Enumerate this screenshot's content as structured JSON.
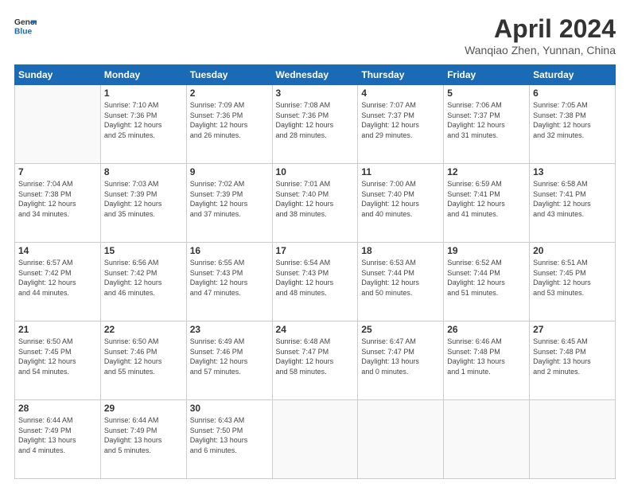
{
  "logo": {
    "line1": "General",
    "line2": "Blue"
  },
  "header": {
    "title": "April 2024",
    "location": "Wanqiao Zhen, Yunnan, China"
  },
  "weekdays": [
    "Sunday",
    "Monday",
    "Tuesday",
    "Wednesday",
    "Thursday",
    "Friday",
    "Saturday"
  ],
  "weeks": [
    [
      {
        "num": "",
        "info": ""
      },
      {
        "num": "1",
        "info": "Sunrise: 7:10 AM\nSunset: 7:36 PM\nDaylight: 12 hours\nand 25 minutes."
      },
      {
        "num": "2",
        "info": "Sunrise: 7:09 AM\nSunset: 7:36 PM\nDaylight: 12 hours\nand 26 minutes."
      },
      {
        "num": "3",
        "info": "Sunrise: 7:08 AM\nSunset: 7:36 PM\nDaylight: 12 hours\nand 28 minutes."
      },
      {
        "num": "4",
        "info": "Sunrise: 7:07 AM\nSunset: 7:37 PM\nDaylight: 12 hours\nand 29 minutes."
      },
      {
        "num": "5",
        "info": "Sunrise: 7:06 AM\nSunset: 7:37 PM\nDaylight: 12 hours\nand 31 minutes."
      },
      {
        "num": "6",
        "info": "Sunrise: 7:05 AM\nSunset: 7:38 PM\nDaylight: 12 hours\nand 32 minutes."
      }
    ],
    [
      {
        "num": "7",
        "info": "Sunrise: 7:04 AM\nSunset: 7:38 PM\nDaylight: 12 hours\nand 34 minutes."
      },
      {
        "num": "8",
        "info": "Sunrise: 7:03 AM\nSunset: 7:39 PM\nDaylight: 12 hours\nand 35 minutes."
      },
      {
        "num": "9",
        "info": "Sunrise: 7:02 AM\nSunset: 7:39 PM\nDaylight: 12 hours\nand 37 minutes."
      },
      {
        "num": "10",
        "info": "Sunrise: 7:01 AM\nSunset: 7:40 PM\nDaylight: 12 hours\nand 38 minutes."
      },
      {
        "num": "11",
        "info": "Sunrise: 7:00 AM\nSunset: 7:40 PM\nDaylight: 12 hours\nand 40 minutes."
      },
      {
        "num": "12",
        "info": "Sunrise: 6:59 AM\nSunset: 7:41 PM\nDaylight: 12 hours\nand 41 minutes."
      },
      {
        "num": "13",
        "info": "Sunrise: 6:58 AM\nSunset: 7:41 PM\nDaylight: 12 hours\nand 43 minutes."
      }
    ],
    [
      {
        "num": "14",
        "info": "Sunrise: 6:57 AM\nSunset: 7:42 PM\nDaylight: 12 hours\nand 44 minutes."
      },
      {
        "num": "15",
        "info": "Sunrise: 6:56 AM\nSunset: 7:42 PM\nDaylight: 12 hours\nand 46 minutes."
      },
      {
        "num": "16",
        "info": "Sunrise: 6:55 AM\nSunset: 7:43 PM\nDaylight: 12 hours\nand 47 minutes."
      },
      {
        "num": "17",
        "info": "Sunrise: 6:54 AM\nSunset: 7:43 PM\nDaylight: 12 hours\nand 48 minutes."
      },
      {
        "num": "18",
        "info": "Sunrise: 6:53 AM\nSunset: 7:44 PM\nDaylight: 12 hours\nand 50 minutes."
      },
      {
        "num": "19",
        "info": "Sunrise: 6:52 AM\nSunset: 7:44 PM\nDaylight: 12 hours\nand 51 minutes."
      },
      {
        "num": "20",
        "info": "Sunrise: 6:51 AM\nSunset: 7:45 PM\nDaylight: 12 hours\nand 53 minutes."
      }
    ],
    [
      {
        "num": "21",
        "info": "Sunrise: 6:50 AM\nSunset: 7:45 PM\nDaylight: 12 hours\nand 54 minutes."
      },
      {
        "num": "22",
        "info": "Sunrise: 6:50 AM\nSunset: 7:46 PM\nDaylight: 12 hours\nand 55 minutes."
      },
      {
        "num": "23",
        "info": "Sunrise: 6:49 AM\nSunset: 7:46 PM\nDaylight: 12 hours\nand 57 minutes."
      },
      {
        "num": "24",
        "info": "Sunrise: 6:48 AM\nSunset: 7:47 PM\nDaylight: 12 hours\nand 58 minutes."
      },
      {
        "num": "25",
        "info": "Sunrise: 6:47 AM\nSunset: 7:47 PM\nDaylight: 13 hours\nand 0 minutes."
      },
      {
        "num": "26",
        "info": "Sunrise: 6:46 AM\nSunset: 7:48 PM\nDaylight: 13 hours\nand 1 minute."
      },
      {
        "num": "27",
        "info": "Sunrise: 6:45 AM\nSunset: 7:48 PM\nDaylight: 13 hours\nand 2 minutes."
      }
    ],
    [
      {
        "num": "28",
        "info": "Sunrise: 6:44 AM\nSunset: 7:49 PM\nDaylight: 13 hours\nand 4 minutes."
      },
      {
        "num": "29",
        "info": "Sunrise: 6:44 AM\nSunset: 7:49 PM\nDaylight: 13 hours\nand 5 minutes."
      },
      {
        "num": "30",
        "info": "Sunrise: 6:43 AM\nSunset: 7:50 PM\nDaylight: 13 hours\nand 6 minutes."
      },
      {
        "num": "",
        "info": ""
      },
      {
        "num": "",
        "info": ""
      },
      {
        "num": "",
        "info": ""
      },
      {
        "num": "",
        "info": ""
      }
    ]
  ]
}
